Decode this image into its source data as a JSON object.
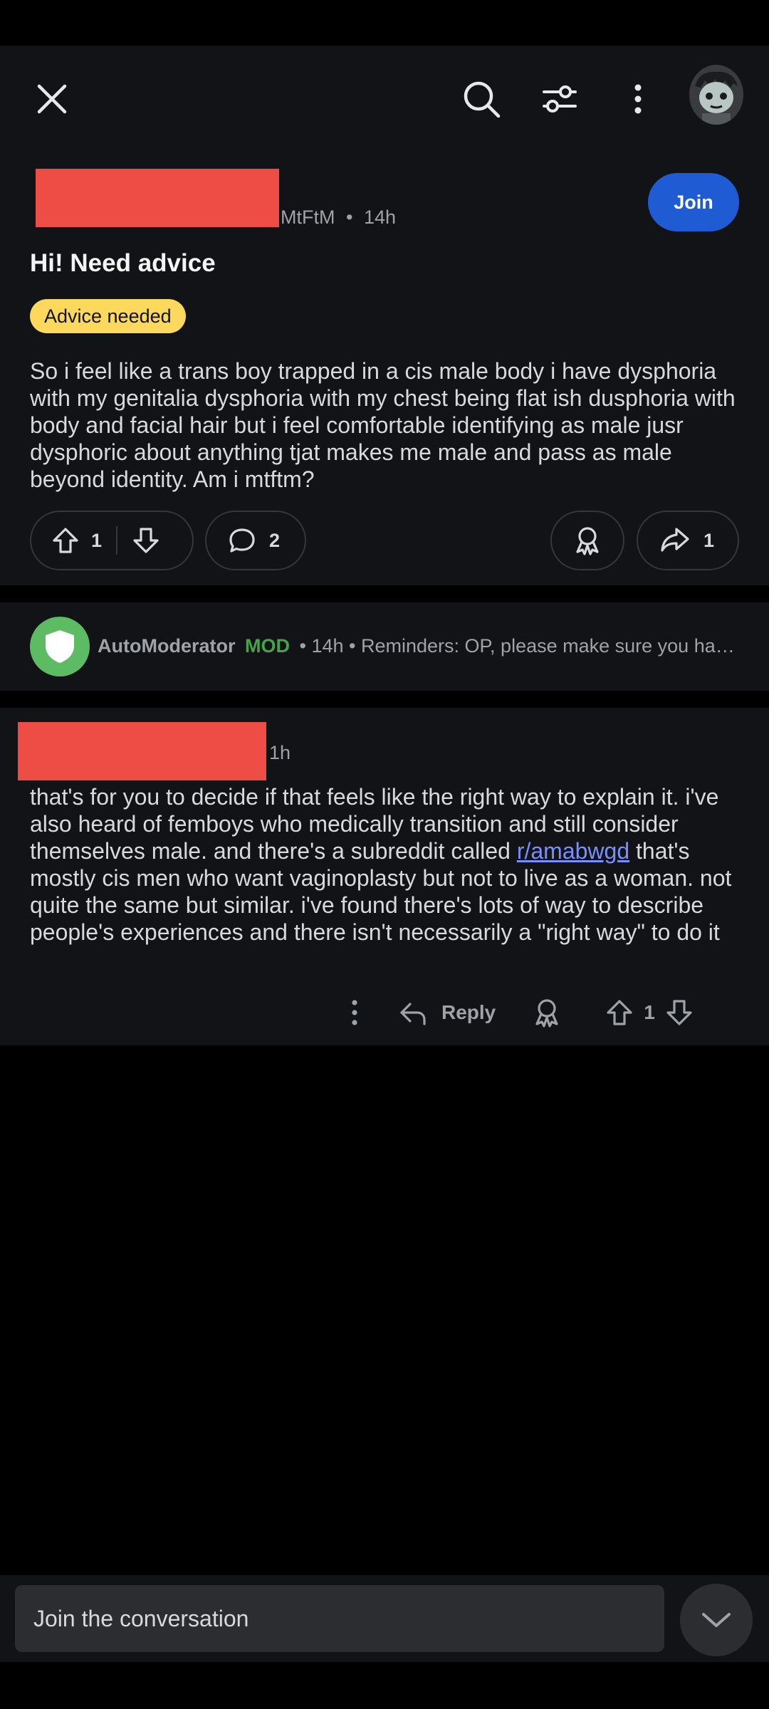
{
  "header": {
    "close_icon": "close-icon",
    "search_icon": "search-icon",
    "filter_icon": "sliders-icon",
    "more_icon": "more-vertical-icon",
    "avatar_icon": "avatar-icon"
  },
  "post": {
    "subreddit": "MtFtM",
    "separator": "•",
    "age": "14h",
    "join_label": "Join",
    "title": "Hi! Need advice",
    "flair": "Advice needed",
    "flair_color": "#fcd95c",
    "body": "So i feel like a trans boy trapped in a cis male body i have dysphoria with my genitalia dysphoria with my chest being flat ish dusphoria with body and facial hair but i feel comfortable identifying as male jusr dysphoric about anything tjat makes me male and pass as male beyond identity. Am i mtftm?",
    "votes": "1",
    "comments": "2",
    "shares": "1"
  },
  "automod": {
    "name": "AutoModerator",
    "badge": "MOD",
    "meta": "• 14h • Reminders: OP, please make sure you hav..."
  },
  "comment": {
    "age": "1h",
    "text_before": "that's for you to decide if that feels like the right way to explain it. i've also heard of femboys who medically transition and still consider themselves male. and there's a subreddit called ",
    "link": "r/amabwgd",
    "text_after": " that's mostly cis men who want vaginoplasty but not to live as a woman. not quite the same but similar. i've found there's lots of way to describe people's experiences and there isn't necessarily a \"right way\" to do it",
    "reply_label": "Reply",
    "votes": "1"
  },
  "composer": {
    "placeholder": "Join the conversation"
  },
  "colors": {
    "accent": "#1f5bd3",
    "mod_green": "#46a34b",
    "link": "#7a8fff",
    "redaction": "#ed4d45"
  }
}
